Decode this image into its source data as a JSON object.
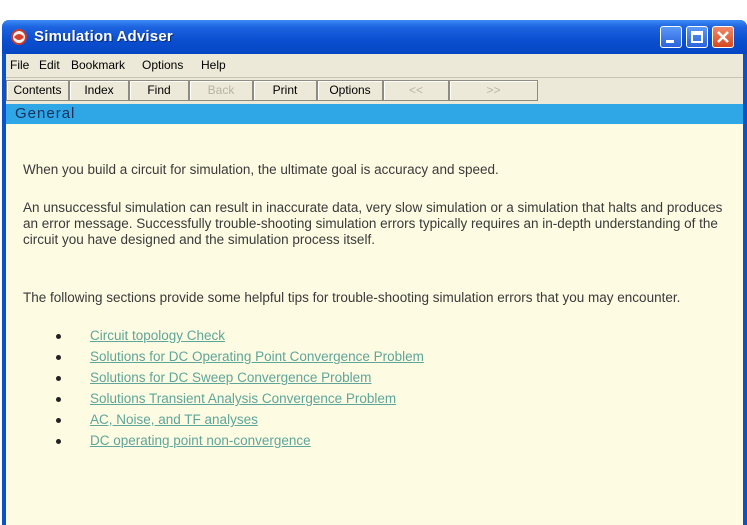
{
  "window": {
    "title": "Simulation Adviser",
    "colors": {
      "titlebar": "#0a4fd0",
      "section_bar": "#2fa6e6",
      "content_bg": "#fdfbe2",
      "link": "#5fa59a"
    }
  },
  "menu": [
    {
      "label": "File"
    },
    {
      "label": "Edit"
    },
    {
      "label": "Bookmark"
    },
    {
      "label": "Options"
    },
    {
      "label": "Help"
    }
  ],
  "toolbar": [
    {
      "label": "Contents",
      "enabled": true
    },
    {
      "label": "Index",
      "enabled": true
    },
    {
      "label": "Find",
      "enabled": true
    },
    {
      "label": "Back",
      "enabled": false
    },
    {
      "label": "Print",
      "enabled": true
    },
    {
      "label": "Options",
      "enabled": true
    },
    {
      "label": "<<",
      "enabled": false
    },
    {
      "label": ">>",
      "enabled": false
    }
  ],
  "section": {
    "title": "General"
  },
  "content": {
    "para1": "When you build a circuit for simulation, the ultimate goal is accuracy and speed.",
    "para2": "An unsuccessful simulation can result in inaccurate data, very slow simulation or a simulation that halts and produces an error message. Successfully trouble-shooting simulation errors typically requires an in-depth understanding of the circuit you have designed and the simulation process itself.",
    "para3": "The following sections provide some helpful tips for trouble-shooting simulation errors that you may encounter.",
    "links": [
      "Circuit topology Check",
      "Solutions for DC Operating Point Convergence Problem",
      "Solutions for DC Sweep Convergence Problem",
      "Solutions Transient Analysis Convergence Problem",
      "AC, Noise, and TF analyses",
      "DC operating point non-convergence"
    ]
  }
}
